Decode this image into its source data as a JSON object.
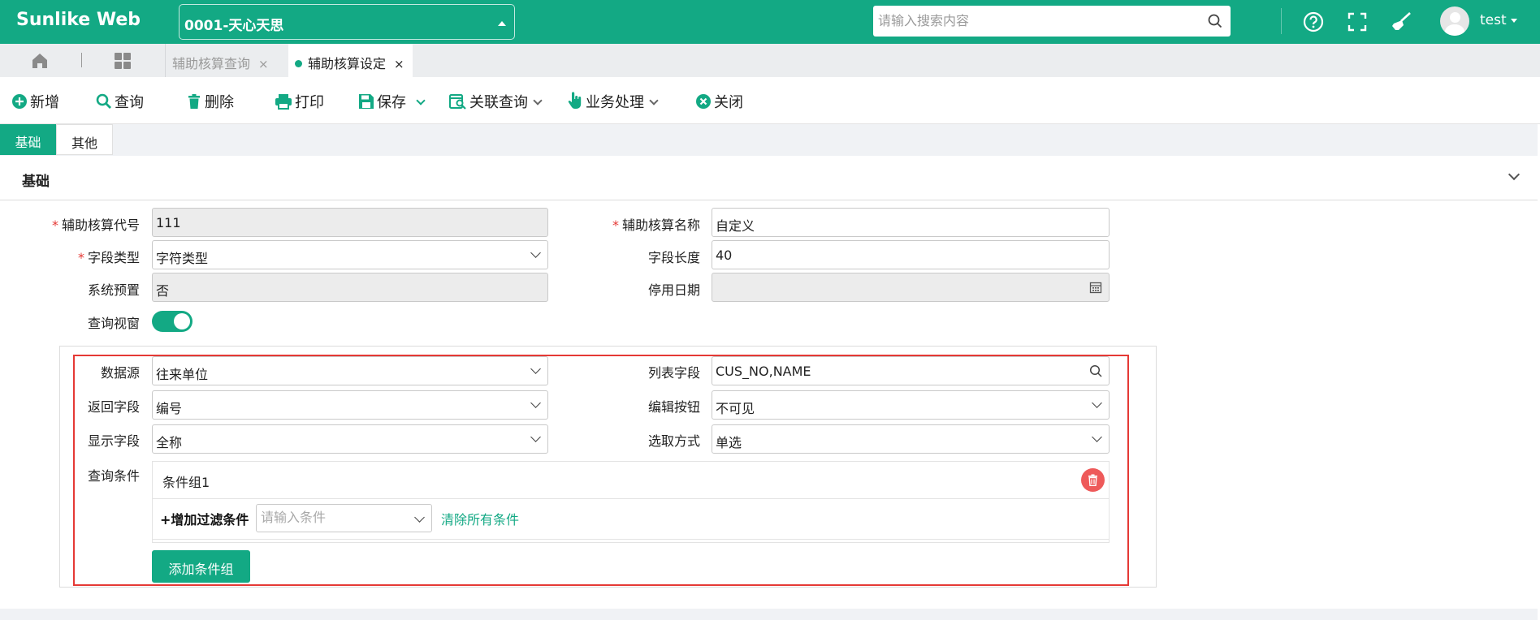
{
  "app": {
    "logo": "Sunlike Web",
    "company": "0001-天心天思",
    "search_placeholder": "请输入搜索内容",
    "user": "test"
  },
  "tabs": [
    {
      "label": "辅助核算查询",
      "close": "×"
    },
    {
      "label": "辅助核算设定",
      "close": "×"
    }
  ],
  "toolbar": {
    "add": "新增",
    "query": "查询",
    "delete": "删除",
    "print": "打印",
    "save": "保存",
    "linked_query": "关联查询",
    "business": "业务处理",
    "close": "关闭"
  },
  "form_tabs": {
    "basic": "基础",
    "other": "其他"
  },
  "section": {
    "title": "基础"
  },
  "form": {
    "code_label": "辅助核算代号",
    "code_value": "111",
    "name_label": "辅助核算名称",
    "name_value": "自定义",
    "type_label": "字段类型",
    "type_value": "字符类型",
    "length_label": "字段长度",
    "length_value": "40",
    "preset_label": "系统预置",
    "preset_value": "否",
    "disable_date_label": "停用日期",
    "disable_date_value": "",
    "query_window_label": "查询视窗",
    "query_window_on": true
  },
  "datasource": {
    "source_label": "数据源",
    "source_value": "往来单位",
    "list_label": "列表字段",
    "list_value": "CUS_NO,NAME",
    "return_label": "返回字段",
    "return_value": "编号",
    "edit_label": "编辑按钮",
    "edit_value": "不可见",
    "display_label": "显示字段",
    "display_value": "全称",
    "pick_label": "选取方式",
    "pick_value": "单选",
    "cond_label": "查询条件",
    "group_title": "条件组1",
    "add_filter": "+增加过滤条件",
    "cond_placeholder": "请输入条件",
    "clear_all": "清除所有条件",
    "add_group": "添加条件组"
  },
  "colors": {
    "brand": "#13a984",
    "required": "#e53935",
    "highlight_box": "#e53935",
    "delete": "#ee5a5a"
  }
}
